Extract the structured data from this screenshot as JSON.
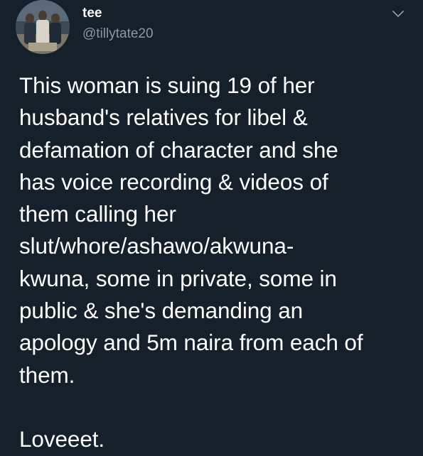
{
  "author": {
    "display_name": "tee",
    "handle": "@tillytate20",
    "avatar": "profile-photo"
  },
  "menu": {
    "icon": "chevron-down-icon"
  },
  "tweet": {
    "text": "This woman is suing 19 of her\nhusband's relatives for libel &\ndefamation of character and she\nhas voice recording & videos of\nthem calling her\nslut/whore/ashawo/akwuna-\nkwuna, some in private, some in\npublic & she's demanding an\napology and 5m naira from each of\nthem.\n\nLoveeet."
  },
  "colors": {
    "background": "#15202b",
    "text_primary": "#ffffff",
    "text_secondary": "#8899a6"
  }
}
